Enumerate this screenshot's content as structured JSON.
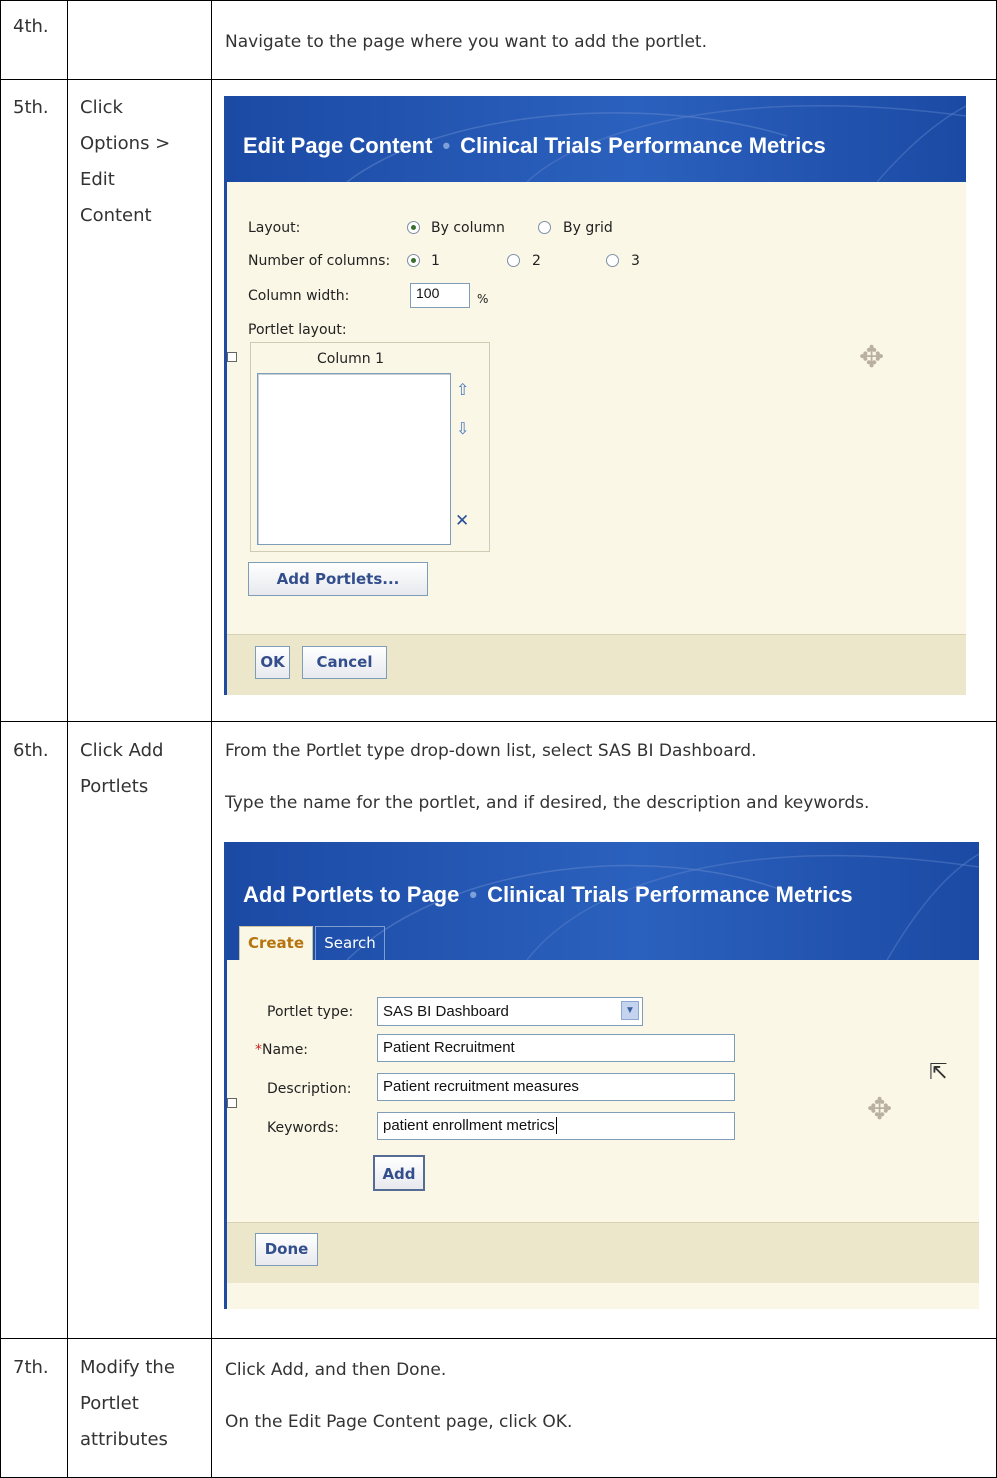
{
  "steps": [
    {
      "num": "4th.",
      "label": "",
      "instructions": [
        "Navigate to the page where you want to add the portlet."
      ]
    },
    {
      "num": "5th.",
      "label": "Click Options > Edit Content",
      "instructions": []
    },
    {
      "num": "6th.",
      "label": "Click Add Portlets",
      "instructions": [
        "From the Portlet type drop-down list, select SAS BI Dashboard.",
        "Type the name for the portlet, and if desired, the description and keywords."
      ]
    },
    {
      "num": "7th.",
      "label": "Modify the Portlet attributes",
      "instructions": [
        "Click Add, and then Done.",
        "On the Edit Page Content page, click OK."
      ]
    }
  ],
  "edit_page": {
    "title": "Edit Page Content",
    "subtitle": "Clinical Trials Performance Metrics",
    "layout_label": "Layout:",
    "layout_options": [
      "By column",
      "By grid"
    ],
    "columns_label": "Number of columns:",
    "columns_options": [
      "1",
      "2",
      "3"
    ],
    "width_label": "Column width:",
    "width_value": "100",
    "width_unit": "%",
    "portlet_layout_label": "Portlet layout:",
    "column_header": "Column 1",
    "add_portlets_button": "Add Portlets...",
    "ok_button": "OK",
    "cancel_button": "Cancel"
  },
  "add_portlets": {
    "title": "Add Portlets to Page",
    "subtitle": "Clinical Trials Performance Metrics",
    "tabs": [
      "Create",
      "Search"
    ],
    "type_label": "Portlet type:",
    "type_value": "SAS BI Dashboard",
    "required_mark": "*",
    "name_label": "Name:",
    "name_value": "Patient Recruitment",
    "description_label": "Description:",
    "description_value": "Patient recruitment measures",
    "keywords_label": "Keywords:",
    "keywords_value": "patient enrollment metrics",
    "add_button": "Add",
    "done_button": "Done"
  },
  "colors": {
    "banner": "#1b4aa4",
    "panel": "#faf7e6",
    "footer": "#ece6cb",
    "button_text": "#334e8c",
    "required": "#cc2222"
  }
}
